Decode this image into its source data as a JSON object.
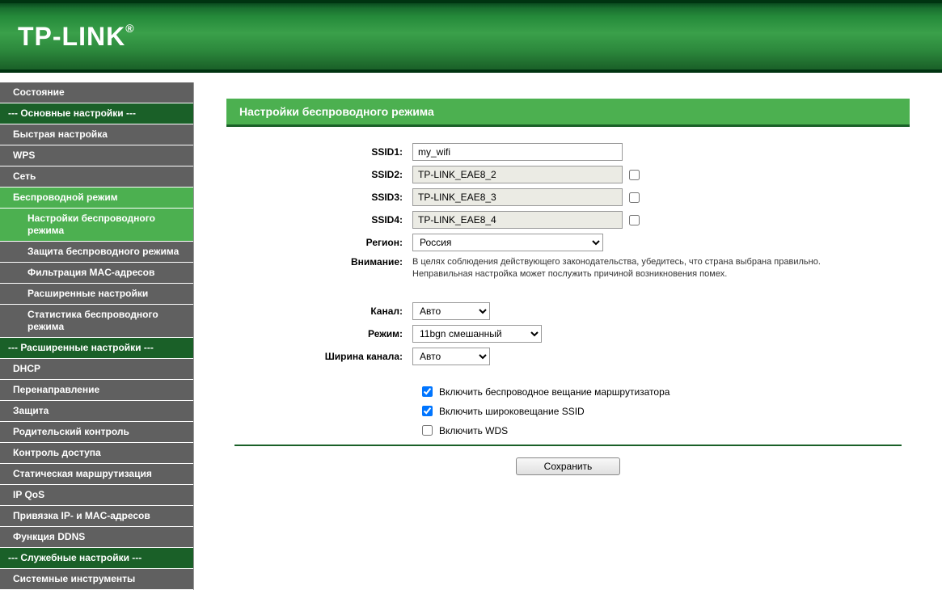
{
  "brand": "TP-LINK",
  "sidebar": {
    "status": "Состояние",
    "section_basic": "--- Основные настройки ---",
    "quick": "Быстрая настройка",
    "wps": "WPS",
    "network": "Сеть",
    "wireless": "Беспроводной режим",
    "wireless_sub": {
      "settings": "Настройки беспроводного режима",
      "security": "Защита беспроводного режима",
      "mac_filter": "Фильтрация MAC-адресов",
      "advanced": "Расширенные настройки",
      "stats": "Статистика беспроводного режима"
    },
    "section_advanced": "--- Расширенные настройки ---",
    "dhcp": "DHCP",
    "forwarding": "Перенаправление",
    "security": "Защита",
    "parental": "Родительский контроль",
    "access": "Контроль доступа",
    "routing": "Статическая маршрутизация",
    "qos": "IP QoS",
    "ipmac": "Привязка IP- и MAC-адресов",
    "ddns": "Функция DDNS",
    "section_service": "--- Служебные настройки ---",
    "system": "Системные инструменты"
  },
  "panel": {
    "title": "Настройки беспроводного режима",
    "labels": {
      "ssid1": "SSID1:",
      "ssid2": "SSID2:",
      "ssid3": "SSID3:",
      "ssid4": "SSID4:",
      "region": "Регион:",
      "warning": "Внимание:",
      "channel": "Канал:",
      "mode": "Режим:",
      "width": "Ширина канала:"
    },
    "values": {
      "ssid1": "my_wifi",
      "ssid2": "TP-LINK_EAE8_2",
      "ssid3": "TP-LINK_EAE8_3",
      "ssid4": "TP-LINK_EAE8_4",
      "region": "Россия",
      "channel": "Авто",
      "mode": "11bgn смешанный",
      "width": "Авто"
    },
    "warning_text": "В целях соблюдения действующего законодательства, убедитесь, что страна выбрана правильно. Неправильная настройка может послужить причиной возникновения помех.",
    "checkboxes": {
      "radio": "Включить беспроводное вещание маршрутизатора",
      "ssid_broadcast": "Включить широковещание SSID",
      "wds": "Включить WDS"
    },
    "save": "Сохранить"
  }
}
